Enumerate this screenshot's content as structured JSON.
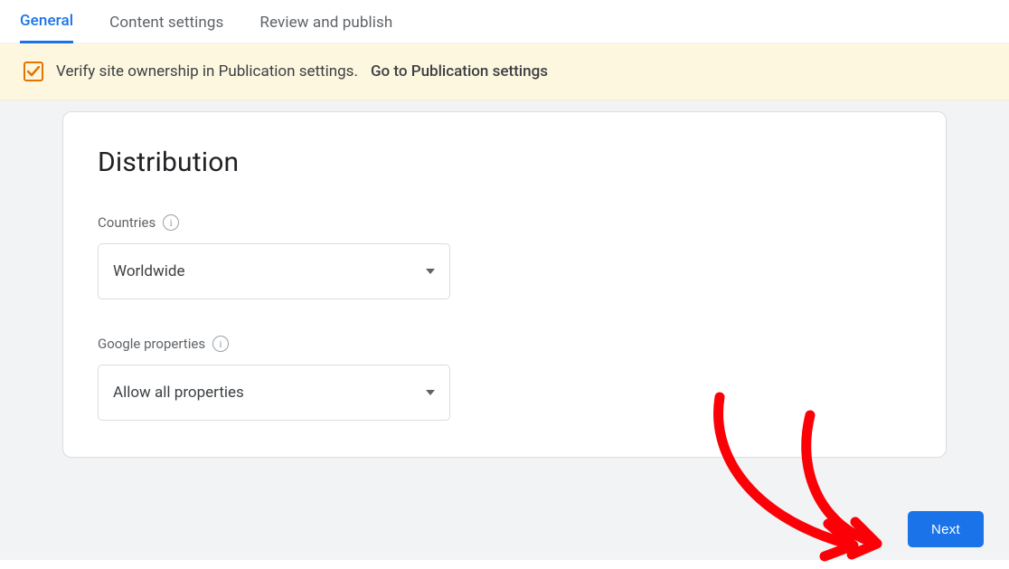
{
  "tabs": {
    "general": "General",
    "content_settings": "Content settings",
    "review_publish": "Review and publish"
  },
  "banner": {
    "message": "Verify site ownership in Publication settings.",
    "link": "Go to Publication settings"
  },
  "card": {
    "title": "Distribution",
    "countries_label": "Countries",
    "countries_value": "Worldwide",
    "google_properties_label": "Google properties",
    "google_properties_value": "Allow all properties"
  },
  "actions": {
    "next": "Next"
  }
}
